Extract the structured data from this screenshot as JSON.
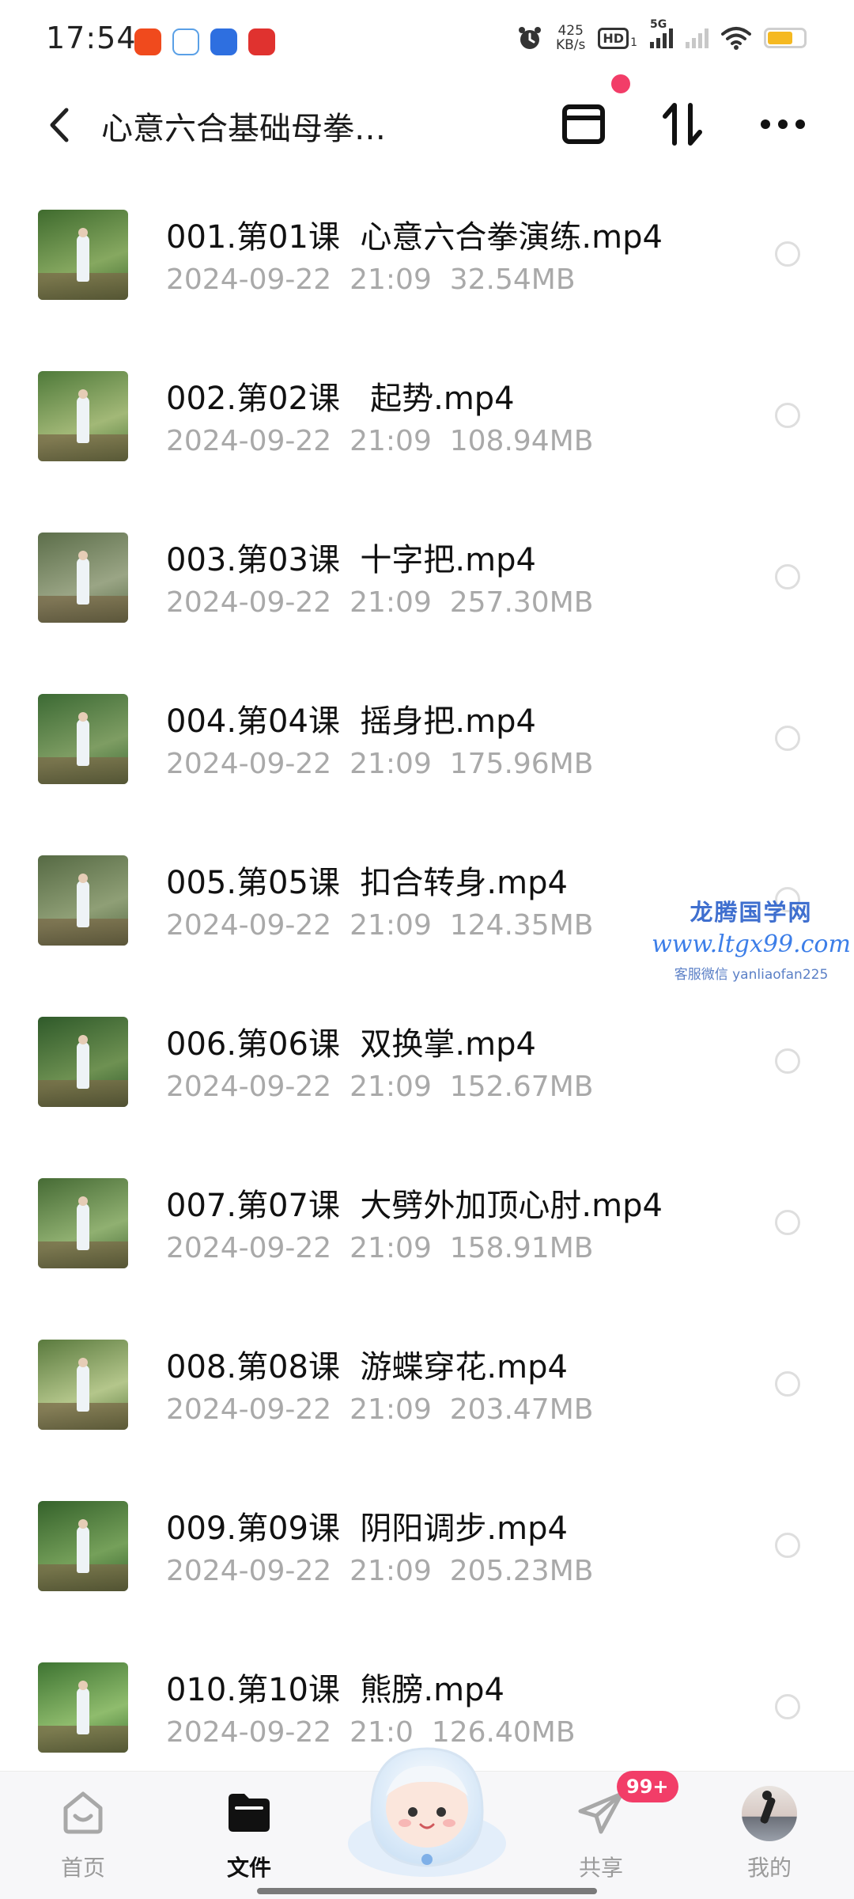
{
  "status_bar": {
    "time": "17:54",
    "net_speed_value": "425",
    "net_speed_unit": "KB/s",
    "hd_label": "HD",
    "hd_sub": "1",
    "network_type": "5G",
    "battery_level": 0.7,
    "battery_color": "#f5b921"
  },
  "header": {
    "title": "心意六合基础母拳…",
    "back_icon": "chevron-left-icon",
    "archive_icon": "archive-box-icon",
    "sort_icon": "sort-arrows-icon",
    "more_icon": "more-dots-icon",
    "notification_dot_color": "#f23d68"
  },
  "files": [
    {
      "name": "001.第01课  心意六合拳演练.mp4",
      "date": "2024-09-22",
      "time": "21:09",
      "size": "32.54MB"
    },
    {
      "name": "002.第02课   起势.mp4",
      "date": "2024-09-22",
      "time": "21:09",
      "size": "108.94MB"
    },
    {
      "name": "003.第03课  十字把.mp4",
      "date": "2024-09-22",
      "time": "21:09",
      "size": "257.30MB"
    },
    {
      "name": "004.第04课  摇身把.mp4",
      "date": "2024-09-22",
      "time": "21:09",
      "size": "175.96MB"
    },
    {
      "name": "005.第05课  扣合转身.mp4",
      "date": "2024-09-22",
      "time": "21:09",
      "size": "124.35MB"
    },
    {
      "name": "006.第06课  双换掌.mp4",
      "date": "2024-09-22",
      "time": "21:09",
      "size": "152.67MB"
    },
    {
      "name": "007.第07课  大劈外加顶心肘.mp4",
      "date": "2024-09-22",
      "time": "21:09",
      "size": "158.91MB"
    },
    {
      "name": "008.第08课  游蝶穿花.mp4",
      "date": "2024-09-22",
      "time": "21:09",
      "size": "203.47MB"
    },
    {
      "name": "009.第09课  阴阳调步.mp4",
      "date": "2024-09-22",
      "time": "21:09",
      "size": "205.23MB"
    },
    {
      "name": "010.第10课  熊膀.mp4",
      "date": "2024-09-22",
      "time": "21:0",
      "size": "126.40MB"
    }
  ],
  "watermark": {
    "title": "龙腾国学网",
    "url": "www.ltgx99.com",
    "contact": "客服微信 yanliaofan225"
  },
  "bottom_nav": {
    "items": [
      {
        "label": "首页",
        "icon": "home-icon",
        "active": false
      },
      {
        "label": "文件",
        "icon": "folder-icon",
        "active": true
      },
      {
        "label": "",
        "icon": "mascot-icon",
        "active": false
      },
      {
        "label": "共享",
        "icon": "paper-plane-icon",
        "active": false
      },
      {
        "label": "我的",
        "icon": "profile-avatar-icon",
        "active": false
      }
    ],
    "share_badge": "99+",
    "badge_color": "#f23d68"
  }
}
